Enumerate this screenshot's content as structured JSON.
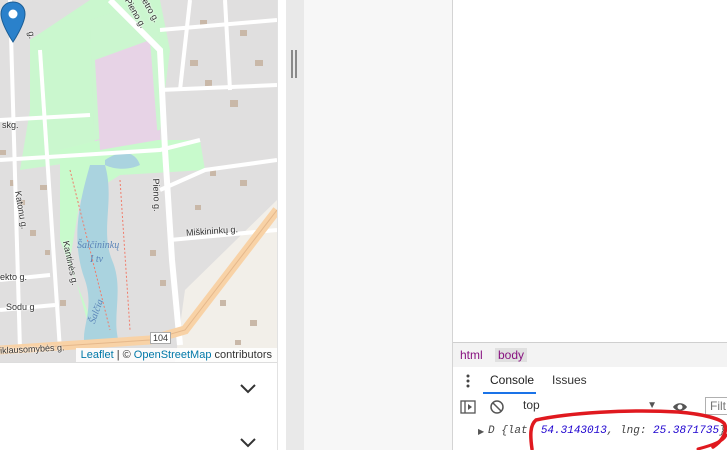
{
  "map": {
    "attribution": {
      "leaflet": "Leaflet",
      "separator": "| ©",
      "osm": "OpenStreetMap",
      "suffix": "contributors"
    },
    "labels": {
      "pieno_top": "Pieno g.",
      "pieno_diag": "Pieno g.",
      "pieno_vertical": "Pieno g.",
      "pieno_top2": "Pietro g.",
      "road_g": "g.",
      "skg": "skg.",
      "katonu": "Katonu g.",
      "kantines": "Kantinės g.",
      "miskininku": "Miškininkų g.",
      "water1": "Šalčininkų",
      "water2": "I tv",
      "river": "Šalčia",
      "ekto": "ekto g.",
      "sodu": "Sodu g",
      "road_number": "104",
      "bottom_street": "iklausomybės g."
    },
    "colors": {
      "water": "#aad3df",
      "park": "#c8facc",
      "residential": "#e0dfdf",
      "school": "#e7d3e6",
      "road_major": "#f8d2a6",
      "road_minor": "#ffffff",
      "marker": "#2a81cb"
    }
  },
  "panel": {
    "rows": [
      {
        "icon": "chevron-down-icon"
      },
      {
        "icon": "chevron-down-icon"
      }
    ]
  },
  "devtools": {
    "breadcrumb": [
      "html",
      "body"
    ],
    "tabs": [
      "Console",
      "Issues"
    ],
    "context": "top",
    "filter_placeholder": "Filt",
    "log": {
      "prefix": "D {lat: ",
      "lat": "54.3143013",
      "mid": ", lng: ",
      "lng": "25.3871735",
      "suffix": "}"
    },
    "accent": "#1a73e8",
    "annotation_color": "#e0191f"
  }
}
